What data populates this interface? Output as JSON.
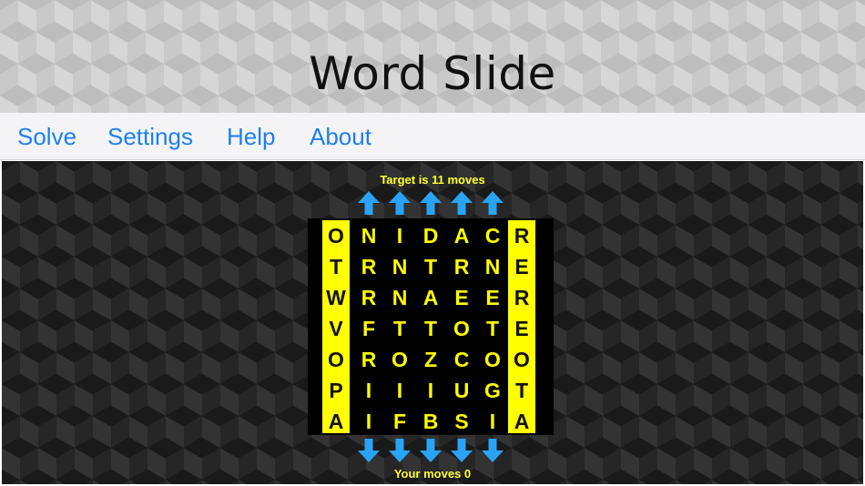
{
  "app": {
    "title": "Word Slide"
  },
  "menu": {
    "items": [
      {
        "label": "Solve"
      },
      {
        "label": "Settings"
      },
      {
        "label": "Help"
      },
      {
        "label": "About"
      }
    ]
  },
  "game": {
    "target_text": "Target is 11 moves",
    "moves_text": "Your moves 0",
    "left_column": [
      "O",
      "T",
      "W",
      "V",
      "O",
      "P",
      "A"
    ],
    "right_column": [
      "R",
      "E",
      "R",
      "E",
      "O",
      "T",
      "A"
    ],
    "center_rows": [
      [
        "N",
        "I",
        "D",
        "A",
        "C"
      ],
      [
        "R",
        "N",
        "T",
        "R",
        "N"
      ],
      [
        "R",
        "N",
        "A",
        "E",
        "E"
      ],
      [
        "F",
        "T",
        "T",
        "O",
        "T"
      ],
      [
        "R",
        "O",
        "Z",
        "C",
        "O"
      ],
      [
        "I",
        "I",
        "I",
        "U",
        "G"
      ],
      [
        "I",
        "F",
        "B",
        "S",
        "I"
      ]
    ],
    "arrow_icon_up": "arrow-up-icon",
    "arrow_icon_down": "arrow-down-icon"
  },
  "colors": {
    "accent_blue": "#1e7ff0",
    "highlight_yellow": "#ffff00",
    "status_yellow": "#ffff33",
    "arrow_blue": "#29a3f5"
  }
}
